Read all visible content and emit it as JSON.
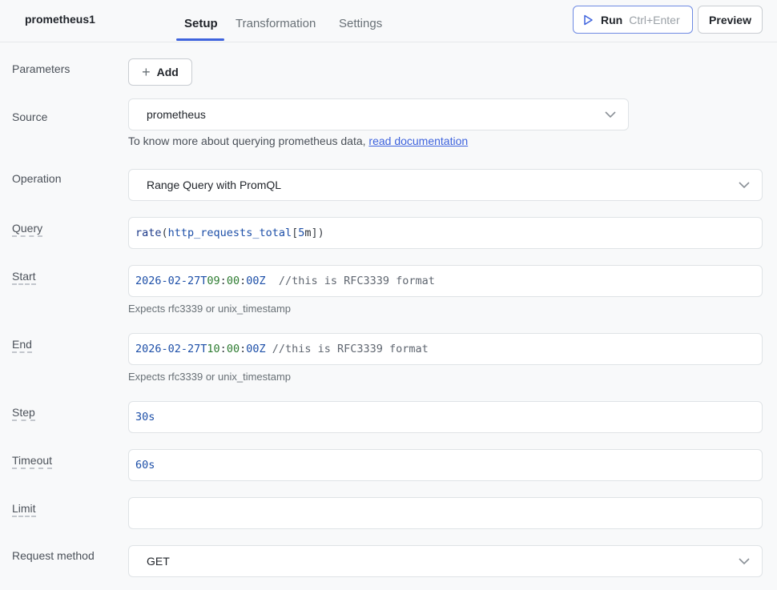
{
  "header": {
    "query_name": "prometheus1",
    "tabs": [
      "Setup",
      "Transformation",
      "Settings"
    ],
    "run_label": "Run",
    "run_shortcut": "Ctrl+Enter",
    "preview_label": "Preview"
  },
  "form": {
    "parameters": {
      "label": "Parameters",
      "add_label": "Add"
    },
    "source": {
      "label": "Source",
      "value": "prometheus",
      "hint_text": "To know more about querying prometheus data, ",
      "hint_link": "read documentation"
    },
    "operation": {
      "label": "Operation",
      "value": "Range Query with PromQL"
    },
    "query": {
      "label": "Query",
      "tokens": {
        "fn": "rate",
        "open": "(",
        "ident": "http_requests_total",
        "lb": "[",
        "num": "5",
        "unit": "m",
        "close": "])"
      }
    },
    "start": {
      "label": "Start",
      "date": "2026-02-27T",
      "hour": "09",
      "c1": ":",
      "minute": "00",
      "c2": ":",
      "second": "00Z",
      "comment": "  //this is RFC3339 format",
      "hint": "Expects rfc3339 or unix_timestamp"
    },
    "end": {
      "label": "End",
      "date": "2026-02-27T",
      "hour": "10",
      "c1": ":",
      "minute": "00",
      "c2": ":",
      "second": "00Z",
      "comment": " //this is RFC3339 format",
      "hint": "Expects rfc3339 or unix_timestamp"
    },
    "step": {
      "label": "Step",
      "value": "30s"
    },
    "timeout": {
      "label": "Timeout",
      "value": "60s"
    },
    "limit": {
      "label": "Limit",
      "value": ""
    },
    "request_method": {
      "label": "Request method",
      "value": "GET"
    }
  },
  "colors": {
    "accent": "#3e63dd",
    "background": "#f8f9fa",
    "input_border": "#dfe3e6"
  },
  "icons": {
    "run": "play-icon",
    "add": "plus-icon",
    "select": "chevron-down-icon"
  }
}
